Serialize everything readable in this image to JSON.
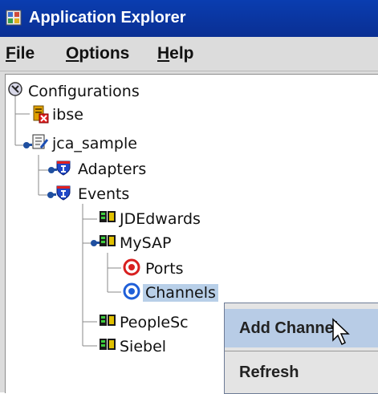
{
  "window": {
    "title": "Application Explorer"
  },
  "menu": {
    "file": {
      "mnemonic": "F",
      "rest": "ile"
    },
    "options": {
      "mnemonic": "O",
      "rest": "ptions"
    },
    "help": {
      "mnemonic": "H",
      "rest": "elp"
    }
  },
  "tree": {
    "root": "Configurations",
    "ibse": "ibse",
    "jca_sample": "jca_sample",
    "adapters": "Adapters",
    "events": "Events",
    "jdedwards": "JDEdwards",
    "mysap": "MySAP",
    "ports": "Ports",
    "channels": "Channels",
    "peoplesoft": "PeopleSc",
    "siebel": "Siebel"
  },
  "context_menu": {
    "add_channel": "Add Channel",
    "refresh": "Refresh"
  },
  "colors": {
    "title_bar": "#0a2f93",
    "selection": "#b8cfe8",
    "menu_hover": "#b8cce6"
  }
}
